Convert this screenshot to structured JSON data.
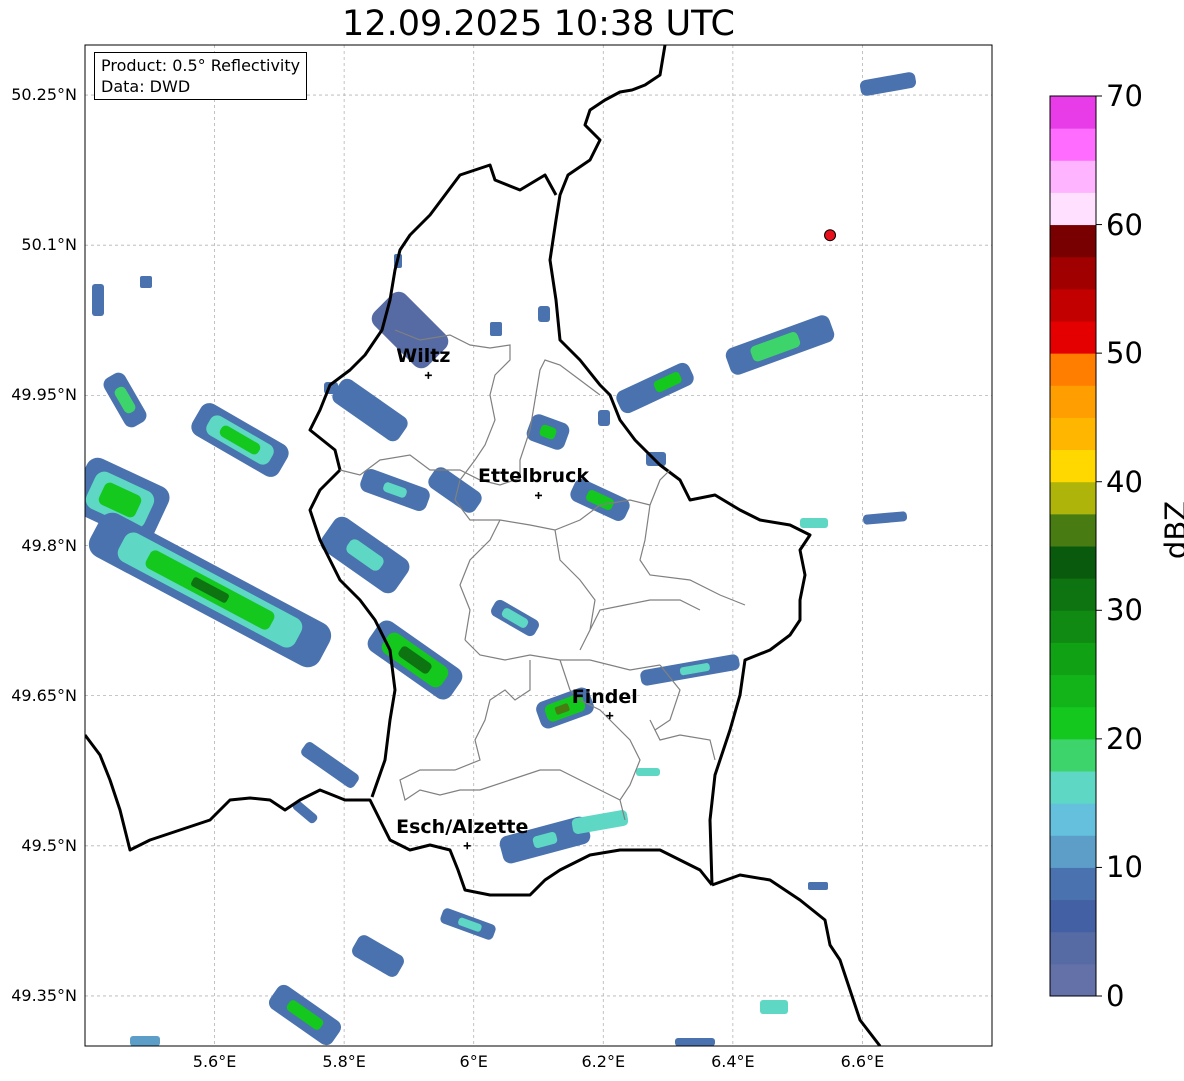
{
  "title": "12.09.2025 10:38 UTC",
  "info": {
    "product": "Product: 0.5° Reflectivity",
    "data": "Data: DWD"
  },
  "map": {
    "lon_range": [
      5.4,
      6.8
    ],
    "lat_range": [
      49.3,
      50.3
    ],
    "lat_ticks": [
      "50.25°N",
      "50.1°N",
      "49.95°N",
      "49.8°N",
      "49.65°N",
      "49.5°N",
      "49.35°N"
    ],
    "lon_ticks": [
      "5.6°E",
      "5.8°E",
      "6°E",
      "6.2°E",
      "6.4°E",
      "6.6°E"
    ],
    "grid": true
  },
  "cities": [
    {
      "name": "Wiltz",
      "lon": 5.93,
      "lat": 49.97
    },
    {
      "name": "Ettelbruck",
      "lon": 6.1,
      "lat": 49.85
    },
    {
      "name": "Findel",
      "lon": 6.21,
      "lat": 49.63
    },
    {
      "name": "Esch/Alzette",
      "lon": 5.99,
      "lat": 49.5
    }
  ],
  "radar_site": {
    "lon": 6.55,
    "lat": 50.11,
    "color": "#e8101a"
  },
  "colorbar": {
    "label": "dBZ",
    "min": 0,
    "max": 70,
    "ticks": [
      "0",
      "10",
      "20",
      "30",
      "40",
      "50",
      "60",
      "70"
    ],
    "colors": [
      "#6470a8",
      "#566aa3",
      "#4460a4",
      "#4a72ae",
      "#5c9ec8",
      "#64c0dc",
      "#5ed8c4",
      "#3ed46c",
      "#14c81e",
      "#12b41a",
      "#10a214",
      "#108a12",
      "#0e7412",
      "#0a5a0e",
      "#487c12",
      "#aeb40a",
      "#ffd800",
      "#ffb600",
      "#ff9e00",
      "#ff7e00",
      "#e40000",
      "#c20000",
      "#a00000",
      "#780000",
      "#ffe0ff",
      "#ffb4ff",
      "#ff6cff",
      "#e83ce8"
    ]
  }
}
